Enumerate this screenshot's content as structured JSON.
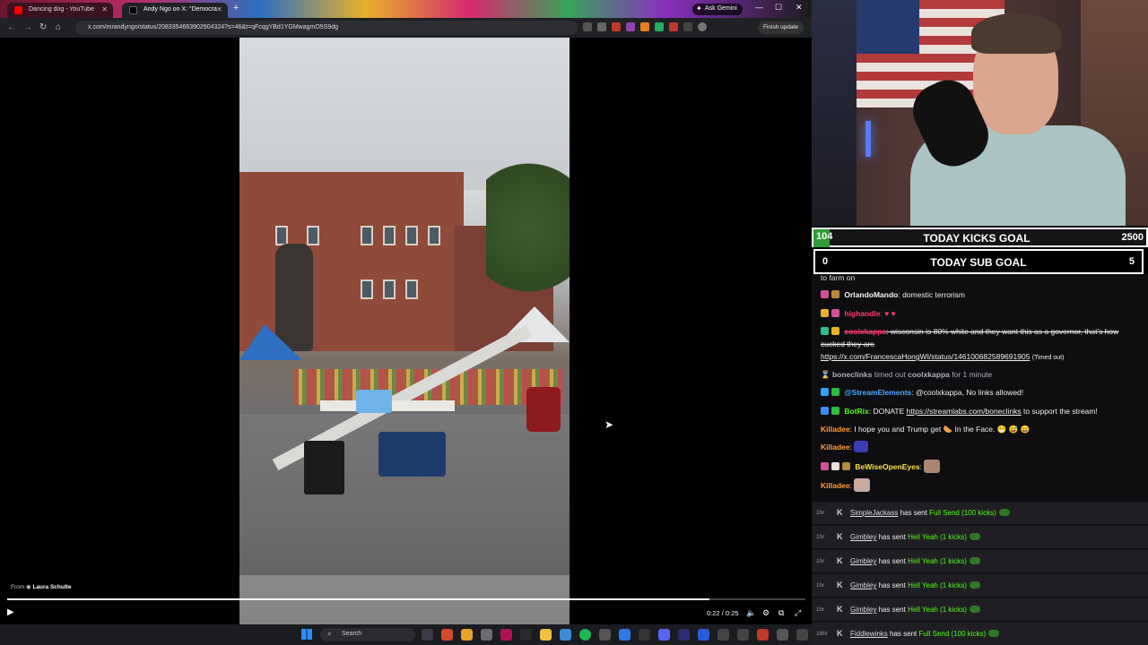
{
  "browser": {
    "tabs": [
      {
        "title": "Dancing dog - YouTube",
        "active": false
      },
      {
        "title": "Andy Ngo on X: \"Democra",
        "active": true
      }
    ],
    "new_tab": "+",
    "gemini_label": "Ask Gemini",
    "url": "x.com/mrandyngo/status/2083354663902904324?s=46&t=qFcqgYBd1YGMwagmO5S9dg",
    "finish_update": "Finish update",
    "window_controls": [
      "—",
      "☐",
      "✕"
    ]
  },
  "video": {
    "from_prefix": "From",
    "from_author": "Laura Schulte",
    "time": "0:22 / 0:25",
    "progress_fraction": 0.88
  },
  "taskbar": {
    "search_placeholder": "Search"
  },
  "goals": {
    "kicks": {
      "current": "104",
      "label": "TODAY KICKS GOAL",
      "target": "2500"
    },
    "subs": {
      "current": "0",
      "label": "TODAY SUB GOAL",
      "target": "5"
    }
  },
  "chat": {
    "cut_text": "to farm on",
    "messages": [
      {
        "user": "OrlandoMando",
        "user_color": "#f5f5f5",
        "text": ": domestic terrorism"
      },
      {
        "user": "highandle",
        "user_color": "#ff3d6e",
        "text": ": ♥ ♥"
      },
      {
        "user": "coolxkappa",
        "user_color": "#ff3d6e",
        "text": ": wisconsin is 80% white and they want this as a governor, that's how cucked they are",
        "link": "https://x.com/FrancescaHongWI/status/1461006825896919​05",
        "suffix": "(Timed out)"
      },
      {
        "system": true,
        "mod": "boneclinks",
        "middle": "timed out",
        "target": "coolxkappa",
        "end": "for 1 minute"
      },
      {
        "user": "@StreamElements",
        "user_color": "#4aa8ff",
        "text": ": @coolxkappa, No links allowed!"
      },
      {
        "user": "BotRix",
        "user_color": "#53fc18",
        "text": ": DONATE ",
        "link": "https://streamlabs.com/boneclinks",
        "suffix": " to support the stream!"
      },
      {
        "user": "Killadee",
        "user_color": "#ff9d3d",
        "text": ": I hope you and Trump get 🌭 In the Face. 😁 😅 😄"
      },
      {
        "user": "Killadee",
        "user_color": "#ff9d3d",
        "text": ":"
      },
      {
        "user": "BeWiseOpenEyes",
        "user_color": "#ffe04a",
        "text": ":"
      },
      {
        "user": "Killadee",
        "user_color": "#ff9d3d",
        "text": ":"
      }
    ]
  },
  "kick_events": [
    {
      "age": "1hr",
      "user": "SimpleJackass",
      "action": "has sent",
      "amount": "Full Send (100 kicks)"
    },
    {
      "age": "1hr",
      "user": "Gimbley",
      "action": "has sent",
      "amount": "Hell Yeah (1 kicks)"
    },
    {
      "age": "1hr",
      "user": "Gimbley",
      "action": "has sent",
      "amount": "Hell Yeah (1 kicks)"
    },
    {
      "age": "1hr",
      "user": "Gimbley",
      "action": "has sent",
      "amount": "Hell Yeah (1 kicks)"
    },
    {
      "age": "1hr",
      "user": "Gimbley",
      "action": "has sent",
      "amount": "Hell Yeah (1 kicks)"
    },
    {
      "age": "18hr",
      "user": "Fiddlewinks",
      "action": "has sent",
      "amount": "Full Send (100 kicks)"
    }
  ],
  "icons": {
    "play": "play-icon",
    "volume": "volume-icon",
    "settings": "gear-icon",
    "pip": "pip-icon",
    "fullscreen": "fullscreen-icon",
    "kick": "kick-logo-icon"
  }
}
